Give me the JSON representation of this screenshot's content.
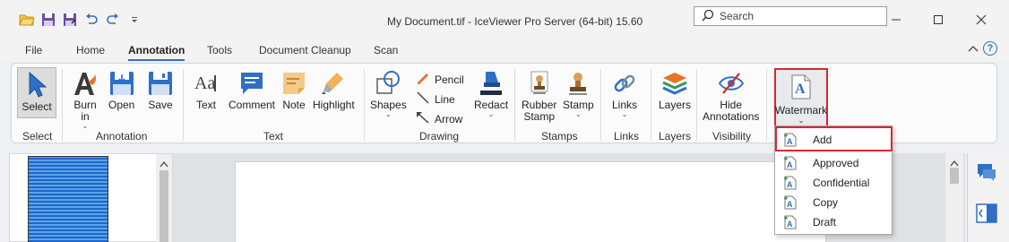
{
  "window": {
    "title": "My Document.tif - IceViewer Pro Server (64-bit) 15.60",
    "search_placeholder": "Search"
  },
  "menu": {
    "tabs": [
      "File",
      "Home",
      "Annotation",
      "Tools",
      "Document Cleanup",
      "Scan"
    ],
    "active": "Annotation"
  },
  "ribbon": {
    "groups": {
      "select": "Select",
      "annotation": "Annotation",
      "text": "Text",
      "drawing": "Drawing",
      "stamps": "Stamps",
      "links": "Links",
      "layers": "Layers",
      "visibility": "Visibility"
    },
    "buttons": {
      "select": "Select",
      "burn_in_1": "Burn",
      "burn_in_2": "in",
      "open": "Open",
      "save": "Save",
      "text": "Text",
      "comment": "Comment",
      "note": "Note",
      "highlight": "Highlight",
      "shapes": "Shapes",
      "pencil": "Pencil",
      "line": "Line",
      "arrow": "Arrow",
      "redact": "Redact",
      "rubber_stamp_1": "Rubber",
      "rubber_stamp_2": "Stamp",
      "stamp": "Stamp",
      "links": "Links",
      "layers": "Layers",
      "hide_annotations_1": "Hide",
      "hide_annotations_2": "Annotations",
      "watermark": "Watermark"
    }
  },
  "watermark_menu": {
    "items": [
      "Add",
      "Approved",
      "Confidential",
      "Copy",
      "Draft"
    ]
  },
  "colors": {
    "accent": "#2f6fc5",
    "highlight_border": "#d7282f",
    "ribbon_bg": "#fbfbfb"
  }
}
